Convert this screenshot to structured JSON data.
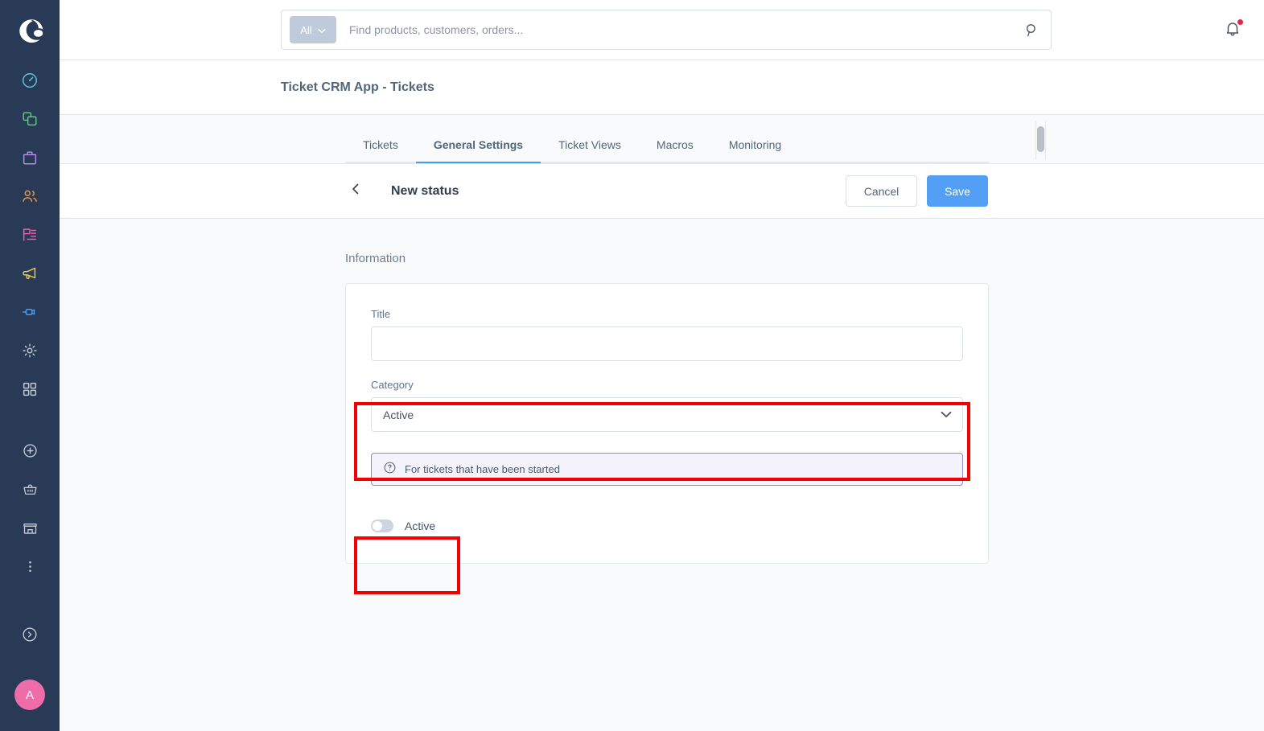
{
  "sidebar": {
    "logo_name": "shopware-logo",
    "items": [
      {
        "name": "dashboard",
        "icon": "gauge-icon",
        "color": "#5ec4d8"
      },
      {
        "name": "catalogues",
        "icon": "layers-icon",
        "color": "#5ec97f"
      },
      {
        "name": "orders",
        "icon": "bag-icon",
        "color": "#b48ce8"
      },
      {
        "name": "customers",
        "icon": "users-icon",
        "color": "#e8934f"
      },
      {
        "name": "content",
        "icon": "content-icon",
        "color": "#e85fa8"
      },
      {
        "name": "marketing",
        "icon": "megaphone-icon",
        "color": "#ecc94b"
      },
      {
        "name": "extensions",
        "icon": "plug-icon",
        "color": "#4a9eed"
      },
      {
        "name": "settings",
        "icon": "gear-icon",
        "color": "#c2c9d4"
      },
      {
        "name": "apps",
        "icon": "grid-icon",
        "color": "#c2c9d4"
      }
    ],
    "quick_items": [
      {
        "name": "add",
        "icon": "plus-circle-icon",
        "color": "#c2c9d4"
      },
      {
        "name": "storefront-basket",
        "icon": "basket-icon",
        "color": "#c2c9d4"
      },
      {
        "name": "sales-channel",
        "icon": "store-icon",
        "color": "#c2c9d4"
      },
      {
        "name": "more",
        "icon": "kebab-icon",
        "color": "#c2c9d4"
      }
    ],
    "collapse": {
      "name": "expand-sidebar",
      "icon": "chevron-right-circle-icon"
    },
    "avatar_initial": "A",
    "avatar_color": "#ee6ca8"
  },
  "topbar": {
    "scope_label": "All",
    "search_placeholder": "Find products, customers, orders...",
    "search_value": "",
    "search_icon": "search-icon",
    "notifications_icon": "bell-icon",
    "has_notification": true
  },
  "header": {
    "page_title": "Ticket CRM App - Tickets"
  },
  "tabs": {
    "items": [
      {
        "label": "Tickets",
        "active": false
      },
      {
        "label": "General Settings",
        "active": true
      },
      {
        "label": "Ticket Views",
        "active": false
      },
      {
        "label": "Macros",
        "active": false
      },
      {
        "label": "Monitoring",
        "active": false
      }
    ]
  },
  "subheader": {
    "back_icon": "chevron-left-icon",
    "title": "New status",
    "cancel_label": "Cancel",
    "save_label": "Save",
    "save_color": "#539ff5"
  },
  "form": {
    "section_label": "Information",
    "title_field": {
      "label": "Title",
      "value": "",
      "placeholder": ""
    },
    "category_field": {
      "label": "Category",
      "selected": "Active",
      "options": [
        "Active"
      ],
      "chevron_icon": "chevron-down-icon"
    },
    "hint": {
      "icon": "question-circle-icon",
      "text": "For tickets that have been started",
      "border_color": "#8b87d8",
      "background_color": "#f4f3fb"
    },
    "active_toggle": {
      "label": "Active",
      "checked": false
    }
  },
  "annotations": {
    "highlight_color": "#f50000",
    "boxes": [
      "category-field",
      "active-toggle"
    ]
  }
}
